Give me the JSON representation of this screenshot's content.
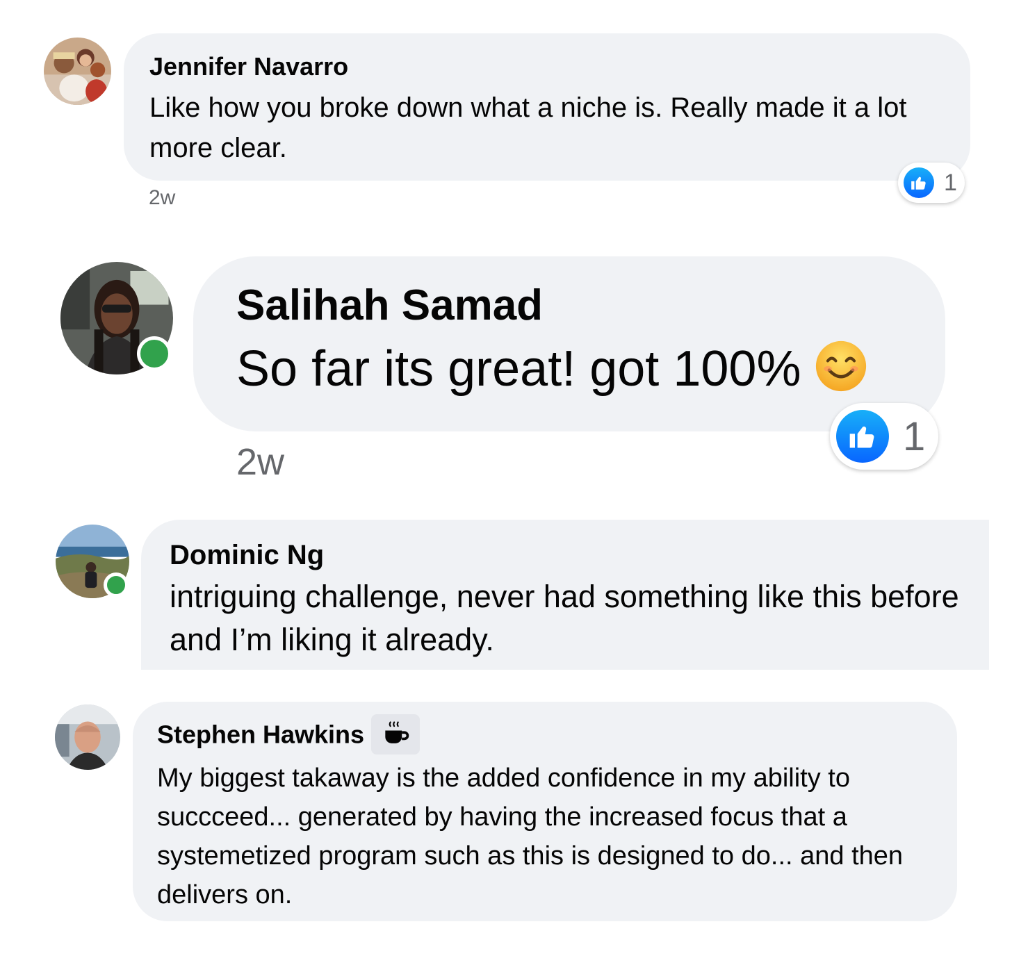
{
  "comments": [
    {
      "author": "Jennifer Navarro",
      "text": "Like how you broke down what a niche is. Really made it a lot more clear.",
      "time": "2w",
      "reaction": {
        "icon": "like-icon",
        "count": "1"
      },
      "online": false
    },
    {
      "author": "Salihah Samad",
      "text": "So far its great! got 100%",
      "emoji": "smiling-face-emoji",
      "time": "2w",
      "reaction": {
        "icon": "like-icon",
        "count": "1"
      },
      "online": true
    },
    {
      "author": "Dominic Ng",
      "text": "intriguing challenge, never had something like this before and I’m liking it already.",
      "online": true
    },
    {
      "author": "Stephen Hawkins",
      "badge": "coffee-cup-icon",
      "text": "My biggest takaway is the added confidence in my ability to succceed... generated by having the increased focus that a systemetized program such as this is designed to do... and then delivers on.",
      "online": false
    }
  ],
  "colors": {
    "bubble": "#f0f2f5",
    "like": "#0866ff",
    "online": "#31a24c",
    "secondary_text": "#65676b"
  }
}
